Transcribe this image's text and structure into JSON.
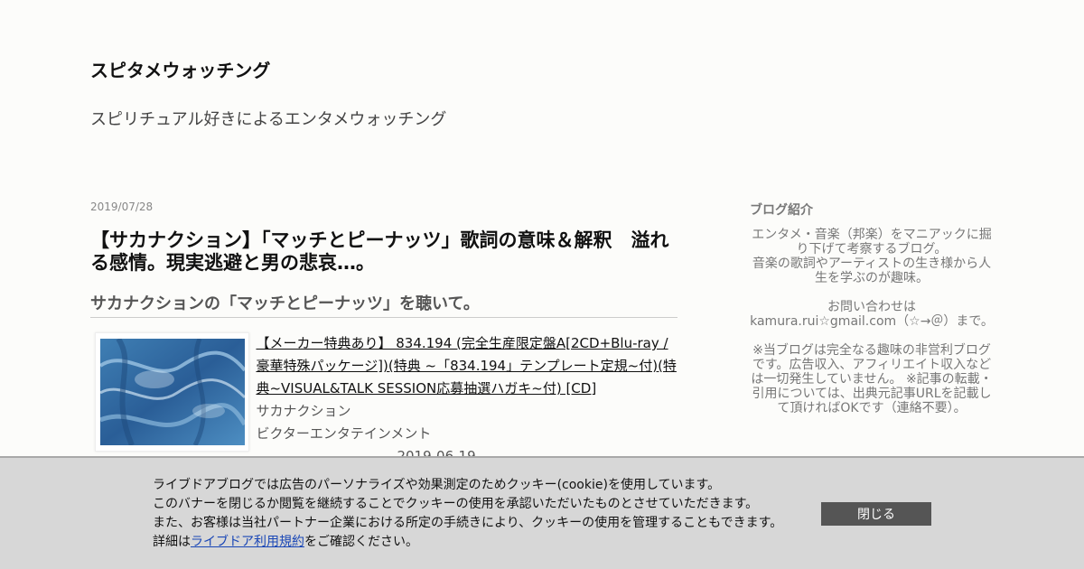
{
  "header": {
    "blog_title": "スピタメウォッチング",
    "blog_description": "スピリチュアル好きによるエンタメウォッチング"
  },
  "post": {
    "date": "2019/07/28",
    "title": "【サカナクション】「マッチとピーナッツ」歌詞の意味＆解釈　溢れる感情。現実逃避と男の悲哀…。",
    "heading": "サカナクションの「マッチとピーナッツ」を聴いて。",
    "product": {
      "link_text": "【メーカー特典あり】 834.194 (完全生産限定盤A[2CD+Blu-ray / 豪華特殊パッケージ])(特典 ~「834.194」テンプレート定規~付)(特典~VISUAL&TALK SESSION応募抽選ハガキ~付) [CD]",
      "artist": "サカナクション",
      "label": "ビクターエンタテインメント",
      "release_date": "2019-06-19"
    }
  },
  "sidebar": {
    "title": "ブログ紹介",
    "text": "エンタメ・音楽（邦楽）をマニアックに掘り下げて考察するブログ。\n音楽の歌詞やアーティストの生き様から人生を学ぶのが趣味。\n\nお問い合わせは\nkamura.rui☆gmail.com（☆→＠）まで。\n\n※当ブログは完全なる趣味の非営利ブログです。広告収入、アフィリエイト収入などは一切発生していません。 ※記事の転載・引用については、出典元記事URLを記載して頂ければOKです（連絡不要）。"
  },
  "cookie_banner": {
    "line1": "ライブドアブログでは広告のパーソナライズや効果測定のためクッキー(cookie)を使用しています。",
    "line2": "このバナーを閉じるか閲覧を継続することでクッキーの使用を承認いただいたものとさせていただきます。",
    "line3": "また、お客様は当社パートナー企業における所定の手続きにより、クッキーの使用を管理することもできます。",
    "line4_prefix": "詳細は",
    "line4_link": "ライブドア利用規約",
    "line4_suffix": "をご確認ください。",
    "close_label": "閉じる"
  }
}
